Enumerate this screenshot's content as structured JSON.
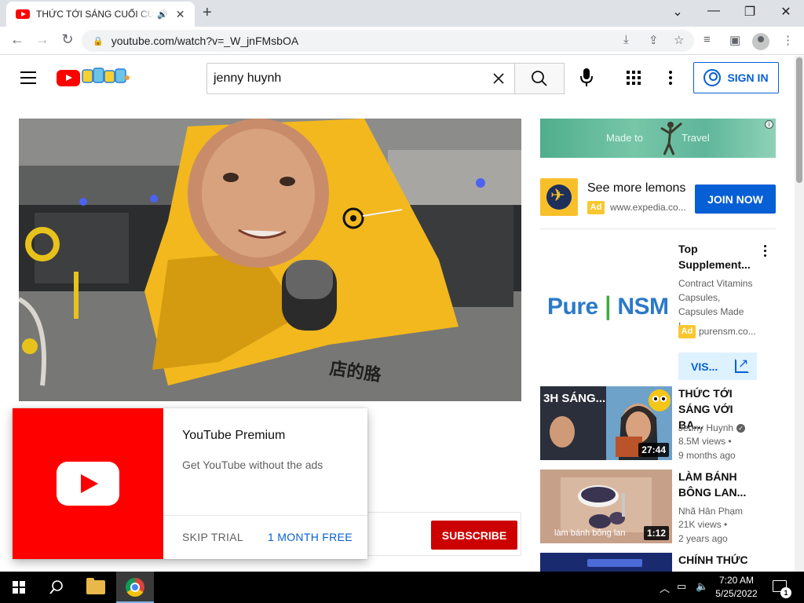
{
  "browser": {
    "tab_title": "THỨC TỚI SÁNG CUỐI CÙNG",
    "url": "youtube.com/watch?v=_W_jnFMsbOA"
  },
  "masthead": {
    "search_value": "jenny huynh",
    "sign_in_label": "SIGN IN"
  },
  "premium_popup": {
    "title": "YouTube Premium",
    "description": "Get YouTube without the ads",
    "skip_label": "SKIP TRIAL",
    "offer_label": "1 MONTH FREE"
  },
  "subscribe_label": "SUBSCRIBE",
  "sidebar": {
    "banner_ad": {
      "left_text": "Made to",
      "right_text": "Travel"
    },
    "expedia_ad": {
      "title": "See more lemons",
      "badge": "Ad",
      "url": "www.expedia.co...",
      "button": "JOIN NOW"
    },
    "supplement_ad": {
      "logo_text_a": "Pure",
      "logo_text_b": "NSM",
      "title": "Top Supplement...",
      "description": "Contract Vitamins Capsules, Capsules Made I...",
      "badge": "Ad",
      "url": "purensm.co...",
      "button": "VIS..."
    },
    "videos": [
      {
        "title": "THỨC TỚI SÁNG VỚI BẠ...",
        "channel": "Jenny Huynh",
        "views": "8.5M views •",
        "age": "9 months ago",
        "duration": "27:44",
        "thumb_text": "3H SÁNG..."
      },
      {
        "title": "LÀM BÁNH BÔNG LAN...",
        "channel": "Nhã Hân Phạm",
        "views": "21K views •",
        "age": "2 years ago",
        "duration": "1:12",
        "thumb_text": "làm bánh bông lan"
      },
      {
        "title": "CHÍNH THỨC"
      }
    ]
  },
  "taskbar": {
    "time": "7:20 AM",
    "date": "5/25/2022",
    "notification_count": "1"
  },
  "colors": {
    "youtube_red": "#ff0000",
    "link_blue": "#065fd4",
    "subscribe_red": "#cc0000",
    "ad_badge": "#f9c72f"
  }
}
